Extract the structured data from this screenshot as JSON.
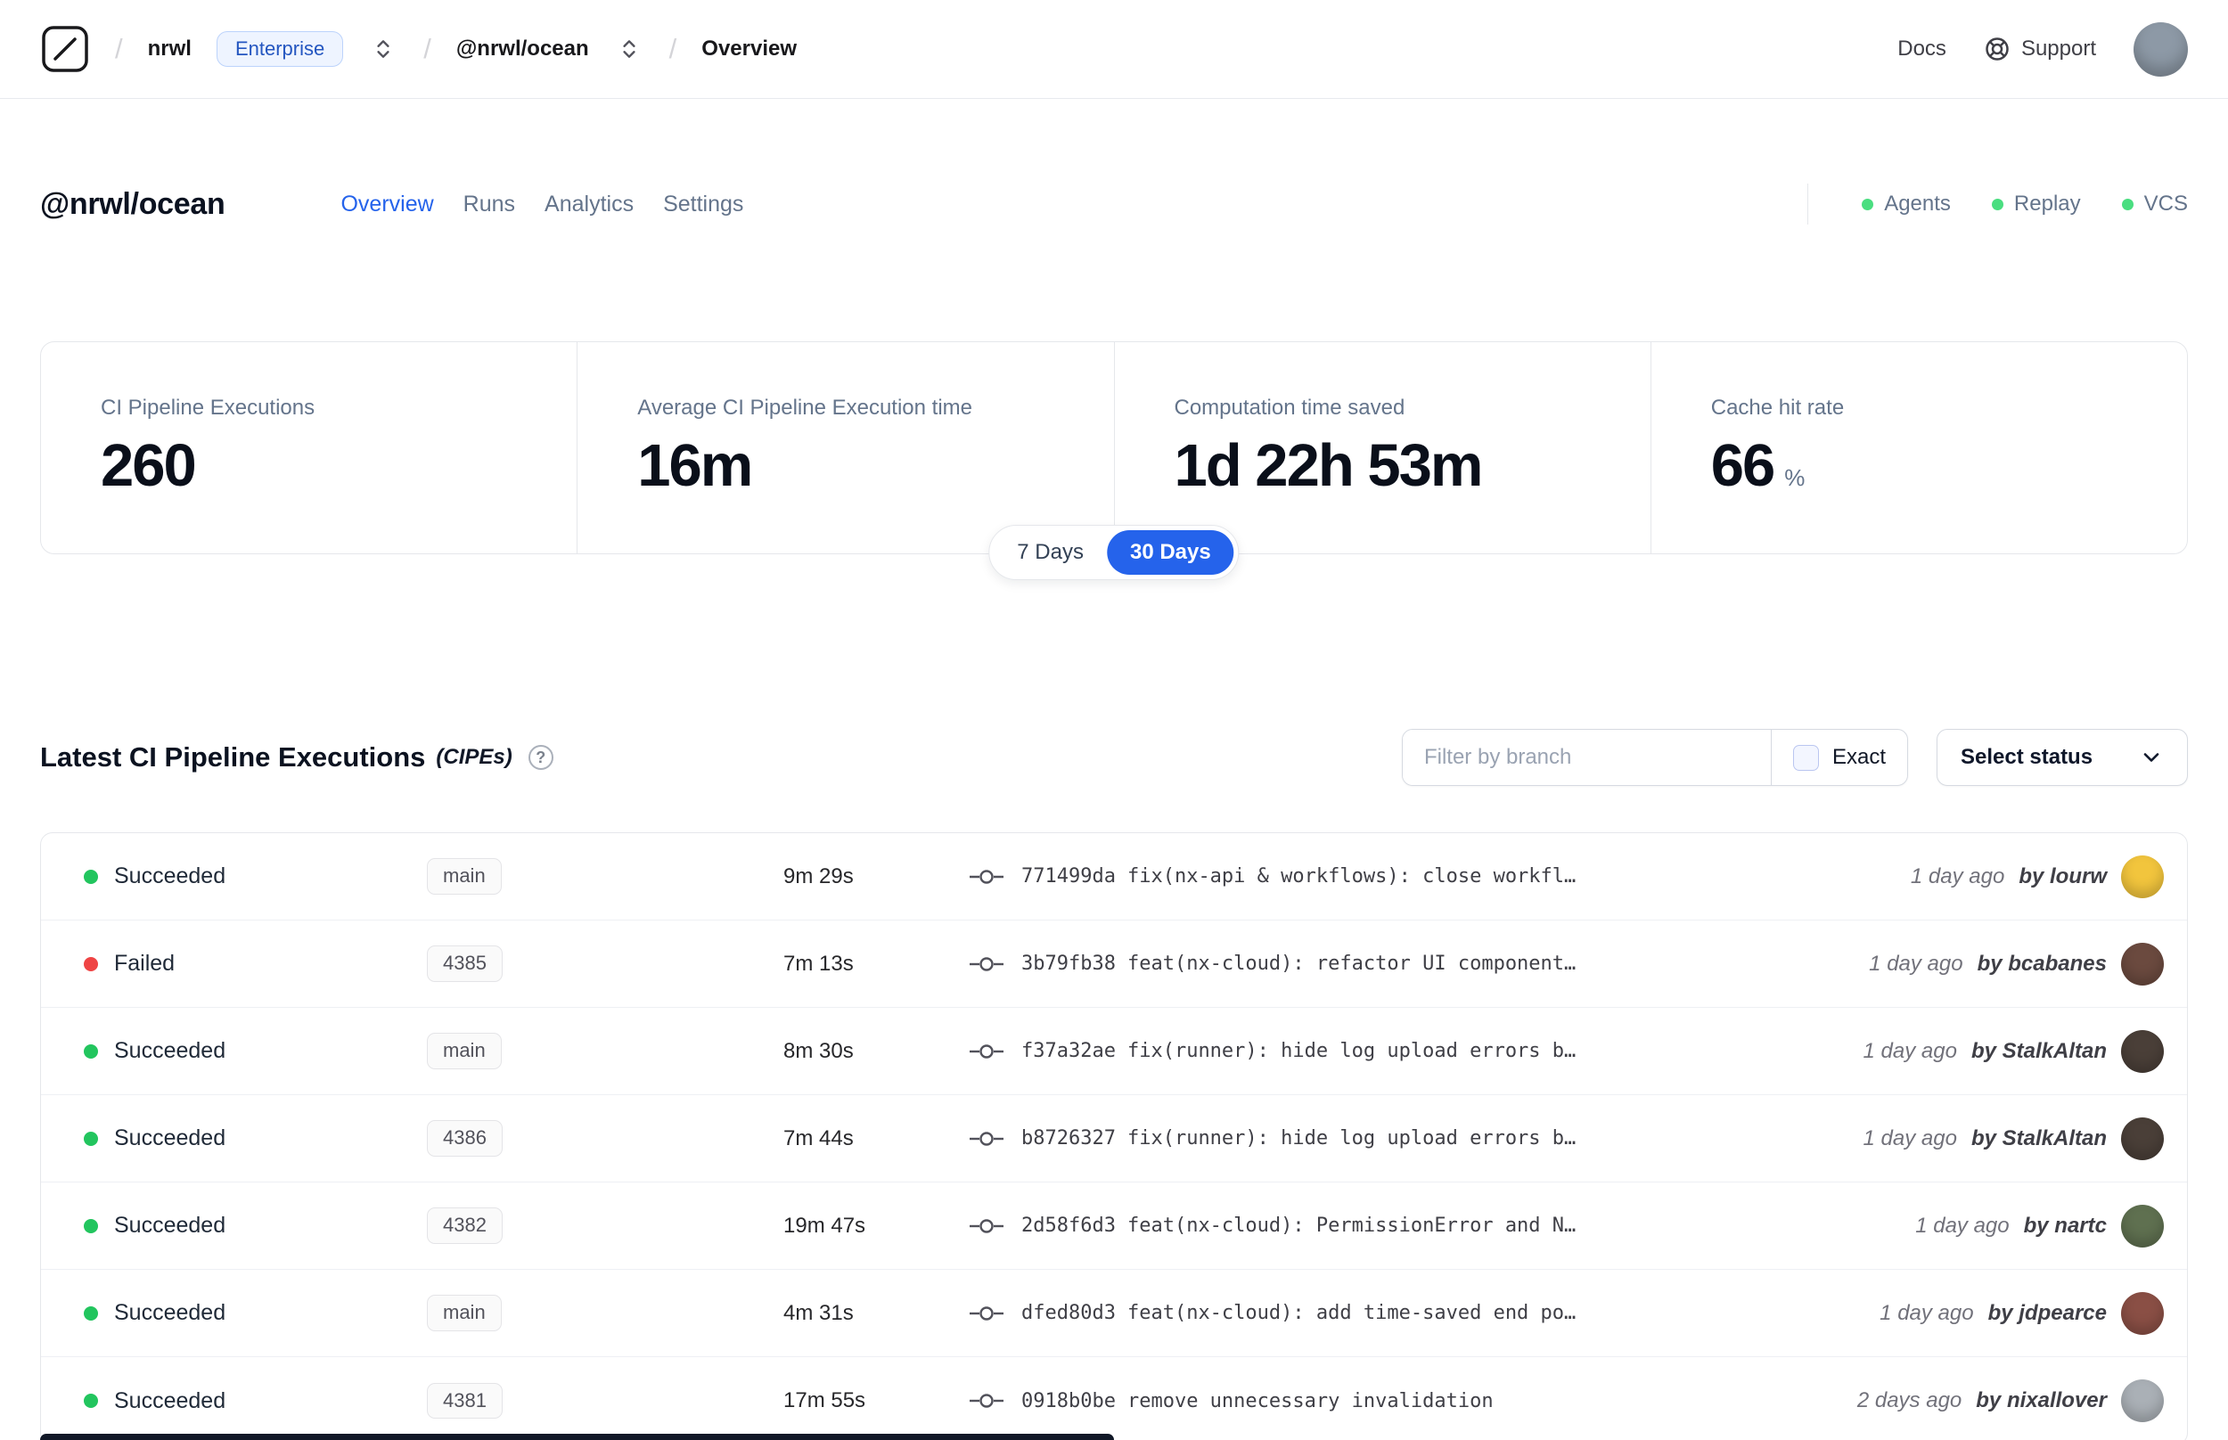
{
  "colors": {
    "accent": "#2563eb",
    "success": "#22c55e",
    "danger": "#ef4444",
    "indicator_green": "#4ade80"
  },
  "navbar": {
    "breadcrumb": {
      "separator": "/",
      "org": "nrwl",
      "org_badge": "Enterprise",
      "workspace": "@nrwl/ocean",
      "page": "Overview"
    },
    "docs_label": "Docs",
    "support_label": "Support",
    "avatar_color": "#8d99a6"
  },
  "header": {
    "title": "@nrwl/ocean",
    "tabs": [
      {
        "label": "Overview",
        "active": true
      },
      {
        "label": "Runs",
        "active": false
      },
      {
        "label": "Analytics",
        "active": false
      },
      {
        "label": "Settings",
        "active": false
      }
    ],
    "indicators": [
      {
        "label": "Agents"
      },
      {
        "label": "Replay"
      },
      {
        "label": "VCS"
      }
    ]
  },
  "stats": {
    "cards": [
      {
        "label": "CI Pipeline Executions",
        "value": "260",
        "unit": ""
      },
      {
        "label": "Average CI Pipeline Execution time",
        "value": "16m",
        "unit": ""
      },
      {
        "label": "Computation time saved",
        "value": "1d 22h 53m",
        "unit": ""
      },
      {
        "label": "Cache hit rate",
        "value": "66",
        "unit": "%"
      }
    ],
    "range_toggle": [
      {
        "label": "7 Days",
        "active": false
      },
      {
        "label": "30 Days",
        "active": true
      }
    ]
  },
  "cipes": {
    "title": "Latest CI Pipeline Executions",
    "title_suffix": "(CIPEs)",
    "help_glyph": "?",
    "filter_placeholder": "Filter by branch",
    "exact_label": "Exact",
    "select_status_label": "Select status",
    "rows": [
      {
        "status": "Succeeded",
        "dot_color": "#22c55e",
        "branch": "main",
        "duration": "9m 29s",
        "commit": "771499da",
        "message": "fix(nx-api & workflows): close workfl…",
        "time": "1 day ago",
        "author": "by lourw",
        "avatar_color": "#f2c53d"
      },
      {
        "status": "Failed",
        "dot_color": "#ef4444",
        "branch": "4385",
        "duration": "7m 13s",
        "commit": "3b79fb38",
        "message": "feat(nx-cloud): refactor UI component…",
        "time": "1 day ago",
        "author": "by bcabanes",
        "avatar_color": "#6b4a3f"
      },
      {
        "status": "Succeeded",
        "dot_color": "#22c55e",
        "branch": "main",
        "duration": "8m 30s",
        "commit": "f37a32ae",
        "message": "fix(runner): hide log upload errors b…",
        "time": "1 day ago",
        "author": "by StalkAltan",
        "avatar_color": "#4a3f38"
      },
      {
        "status": "Succeeded",
        "dot_color": "#22c55e",
        "branch": "4386",
        "duration": "7m 44s",
        "commit": "b8726327",
        "message": "fix(runner): hide log upload errors b…",
        "time": "1 day ago",
        "author": "by StalkAltan",
        "avatar_color": "#4a3f38"
      },
      {
        "status": "Succeeded",
        "dot_color": "#22c55e",
        "branch": "4382",
        "duration": "19m 47s",
        "commit": "2d58f6d3",
        "message": "feat(nx-cloud): PermissionError and N…",
        "time": "1 day ago",
        "author": "by nartc",
        "avatar_color": "#5f7050"
      },
      {
        "status": "Succeeded",
        "dot_color": "#22c55e",
        "branch": "main",
        "duration": "4m 31s",
        "commit": "dfed80d3",
        "message": "feat(nx-cloud): add time-saved end po…",
        "time": "1 day ago",
        "author": "by jdpearce",
        "avatar_color": "#8a4f45"
      },
      {
        "status": "Succeeded",
        "dot_color": "#22c55e",
        "branch": "4381",
        "duration": "17m 55s",
        "commit": "0918b0be",
        "message": "remove unnecessary invalidation",
        "time": "2 days ago",
        "author": "by nixallover",
        "avatar_color": "#aab0b6"
      }
    ]
  }
}
